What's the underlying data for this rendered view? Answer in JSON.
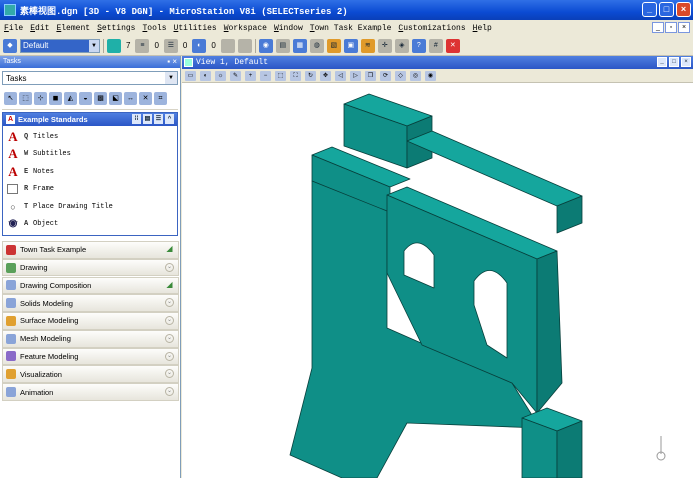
{
  "window": {
    "title": "素棒视图.dgn [3D - V8 DGN] - MicroStation V8i (SELECTseries 2)"
  },
  "menu": {
    "items": [
      "File",
      "Edit",
      "Element",
      "Settings",
      "Tools",
      "Utilities",
      "Workspace",
      "Window",
      "Town Task Example",
      "Customizations",
      "Help"
    ]
  },
  "attributes": {
    "level": "Default",
    "color": "7",
    "line_style": "0",
    "line_weight": "0",
    "transparency": "0",
    "accent_color": "#1fb0a8"
  },
  "tasks_panel": {
    "header": "Tasks",
    "task_combo": "Tasks",
    "active_section": {
      "label": "Example Standards",
      "tools": [
        {
          "key": "Q",
          "label": "Titles",
          "icon": "text-a-icon"
        },
        {
          "key": "W",
          "label": "Subtitles",
          "icon": "text-a-icon"
        },
        {
          "key": "E",
          "label": "Notes",
          "icon": "text-a-icon"
        },
        {
          "key": "R",
          "label": "Frame",
          "icon": "frame-icon"
        },
        {
          "key": "T",
          "label": "Place Drawing Title",
          "icon": "drawing-title-icon"
        },
        {
          "key": "A",
          "label": "Object",
          "icon": "object-icon"
        }
      ]
    },
    "sections": [
      {
        "label": "Town Task Example",
        "icon": "town-icon"
      },
      {
        "label": "Drawing",
        "icon": "drawing-icon"
      },
      {
        "label": "Drawing Composition",
        "icon": "drawing-composition-icon"
      },
      {
        "label": "Solids Modeling",
        "icon": "solids-icon"
      },
      {
        "label": "Surface Modeling",
        "icon": "surface-icon"
      },
      {
        "label": "Mesh Modeling",
        "icon": "mesh-icon"
      },
      {
        "label": "Feature Modeling",
        "icon": "feature-icon"
      },
      {
        "label": "Visualization",
        "icon": "visualization-icon"
      },
      {
        "label": "Animation",
        "icon": "animation-icon"
      }
    ]
  },
  "view": {
    "title": "View 1, Default",
    "model_colors": {
      "front": "#0f8f87",
      "top": "#15a69d",
      "side": "#0c7b74",
      "edge": "#073f3b"
    }
  }
}
